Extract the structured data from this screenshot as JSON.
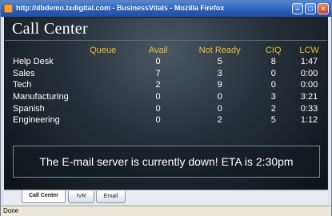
{
  "window": {
    "title": "http://dbdemo.txdigital.com - BusinessVitals - Mozilla Firefox"
  },
  "app": {
    "title": "Call Center"
  },
  "table": {
    "headers": {
      "queue": "Queue",
      "avail": "Avail",
      "not_ready": "Not Ready",
      "ciq": "CIQ",
      "lcw": "LCW"
    },
    "rows": [
      {
        "queue": "Help Desk",
        "avail": "0",
        "not_ready": "5",
        "ciq": "8",
        "lcw": "1:47"
      },
      {
        "queue": "Sales",
        "avail": "7",
        "not_ready": "3",
        "ciq": "0",
        "lcw": "0:00"
      },
      {
        "queue": "Tech",
        "avail": "2",
        "not_ready": "9",
        "ciq": "0",
        "lcw": "0:00"
      },
      {
        "queue": "Manufacturing",
        "avail": "0",
        "not_ready": "0",
        "ciq": "3",
        "lcw": "3:21"
      },
      {
        "queue": "Spanish",
        "avail": "0",
        "not_ready": "0",
        "ciq": "2",
        "lcw": "0:33"
      },
      {
        "queue": "Engineering",
        "avail": "0",
        "not_ready": "2",
        "ciq": "5",
        "lcw": "1:12"
      }
    ]
  },
  "alert": {
    "message": "The E-mail server is currently down! ETA is 2:30pm"
  },
  "tabs": [
    {
      "label": "Call Center",
      "active": true
    },
    {
      "label": "IVR",
      "active": false
    },
    {
      "label": "Email",
      "active": false
    }
  ],
  "status": {
    "text": "Done"
  },
  "colors": {
    "header_text": "#e6c23a",
    "cell_text": "#ffffff",
    "titlebar": "#2a5db8"
  }
}
